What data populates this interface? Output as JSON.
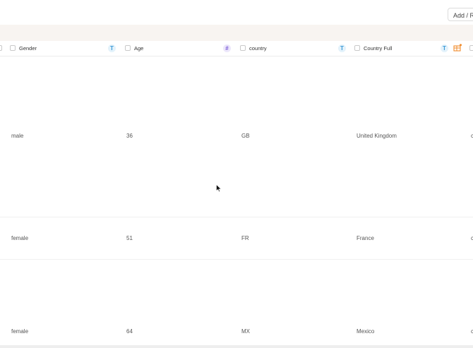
{
  "toolbar": {
    "add_button_label": "Add / Remove"
  },
  "columns": [
    {
      "label": "Gender",
      "type_icon": "T"
    },
    {
      "label": "Age",
      "type_icon": "#"
    },
    {
      "label": "country",
      "type_icon": "T"
    },
    {
      "label": "Country Full",
      "type_icon": "T"
    }
  ],
  "rows": [
    {
      "gender": "male",
      "age": "36",
      "country": "GB",
      "country_full": "United Kingdom",
      "extra": "c"
    },
    {
      "gender": "female",
      "age": "51",
      "country": "FR",
      "country_full": "France",
      "extra": "c"
    },
    {
      "gender": "female",
      "age": "64",
      "country": "MX",
      "country_full": "Mexico",
      "extra": "c"
    }
  ],
  "colors": {
    "banner": "#f8f4f1",
    "text_badge": "#3d9ad6",
    "number_badge": "#7a5ad6",
    "accent_orange": "#f08c2e"
  }
}
